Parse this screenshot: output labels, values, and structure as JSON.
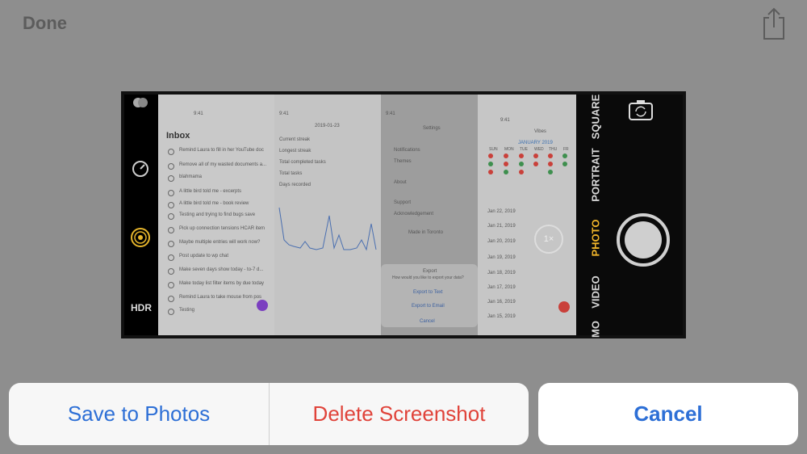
{
  "topbar": {
    "done_label": "Done",
    "share_icon": "share-icon"
  },
  "camera": {
    "hdr_label": "HDR",
    "modes": [
      "SQUARE",
      "PORTRAIT",
      "PHOTO",
      "VIDEO",
      "MO"
    ],
    "active_mode": "PHOTO",
    "zoom_label": "1×"
  },
  "screenshot": {
    "inbox": {
      "time": "9:41",
      "title": "Inbox",
      "items": [
        "Remind Laura to fill in her YouTube doc",
        "Remove all of my wasted documents a...",
        "blahmama",
        "A little bird told me - excerpts",
        "A little bird told me - book review",
        "Testing and trying to find bugs save",
        "Pick up connection tensions HCAR item",
        "Maybe multiple entries will work now?",
        "Post update to wp chat",
        "Make seven days show today - to-7 d...",
        "Make today list filter items by due today",
        "Remind Laura to take mouse from pos",
        "Testing"
      ]
    },
    "stats": {
      "time": "9:41",
      "date": "2019-01-23",
      "rows": [
        "Current streak",
        "Longest streak",
        "Total completed tasks",
        "Total tasks",
        "Days recorded"
      ]
    },
    "settings": {
      "time": "9:41",
      "title": "Settings",
      "items": [
        "Notifications",
        "Themes",
        "About",
        "Support",
        "Acknowledgement"
      ],
      "made_in": "Made in Toronto",
      "export_title": "Export",
      "export_sub": "How would you like to export your data?",
      "export_text": "Export to Text",
      "export_email": "Export to Email",
      "cancel": "Cancel"
    },
    "vibes": {
      "time": "9:41",
      "title": "Vibes",
      "month": "JANUARY 2019",
      "days": [
        "SUN",
        "MON",
        "TUE",
        "WED",
        "THU",
        "FR"
      ],
      "dates": [
        "Jan 22, 2019",
        "Jan 21, 2019",
        "Jan 20, 2019",
        "Jan 19, 2019",
        "Jan 18, 2019",
        "Jan 17, 2019",
        "Jan 16, 2019",
        "Jan 15, 2019"
      ]
    }
  },
  "sheet": {
    "save_label": "Save to Photos",
    "delete_label": "Delete Screenshot",
    "cancel_label": "Cancel",
    "colors": {
      "blue": "#2d6fd6",
      "red": "#e0433a"
    }
  }
}
